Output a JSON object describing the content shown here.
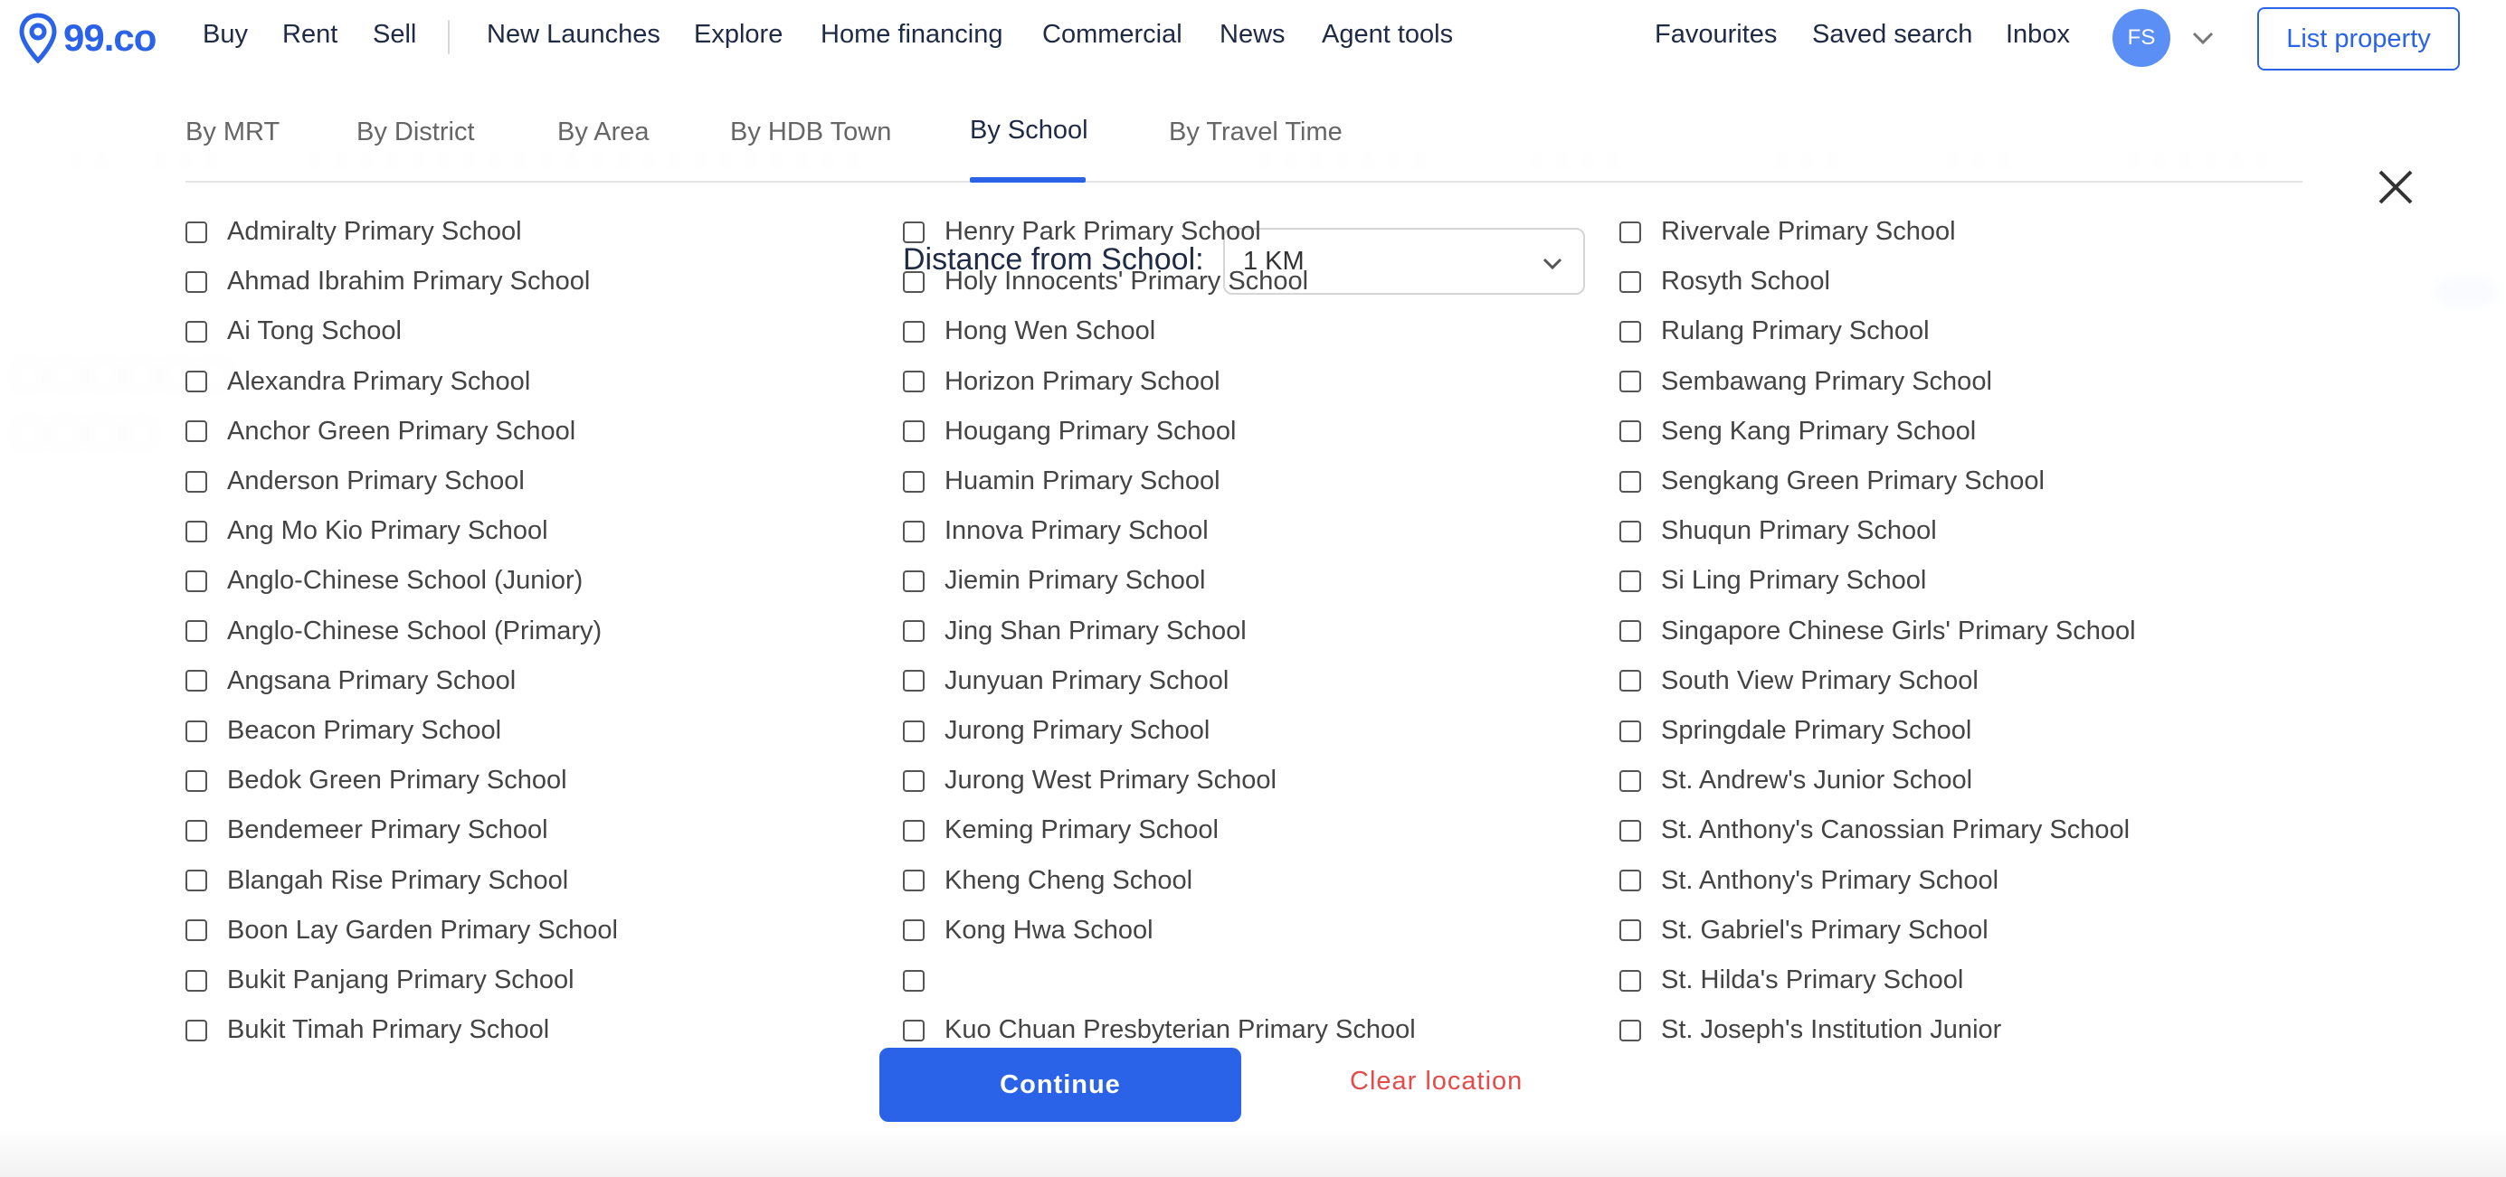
{
  "brand": {
    "logo_text": "99.co",
    "accent": "#2b63e8"
  },
  "nav": {
    "items": [
      "Buy",
      "Rent",
      "Sell",
      "New Launches",
      "Explore",
      "Home financing",
      "Commercial",
      "News",
      "Agent tools"
    ],
    "right_items": [
      "Favourites",
      "Saved search",
      "Inbox"
    ],
    "avatar_initials": "FS",
    "list_property_label": "List property"
  },
  "modal": {
    "tabs": [
      "By MRT",
      "By District",
      "By Area",
      "By HDB Town",
      "By School",
      "By Travel Time"
    ],
    "active_tab": "By School",
    "distance_label": "Distance from School:",
    "distance_value": "1 KM",
    "columns": [
      [
        "Admiralty Primary School",
        "Ahmad Ibrahim Primary School",
        "Ai Tong School",
        "Alexandra Primary School",
        "Anchor Green Primary School",
        "Anderson Primary School",
        "Ang Mo Kio Primary School",
        "Anglo-Chinese School (Junior)",
        "Anglo-Chinese School (Primary)",
        "Angsana Primary School",
        "Beacon Primary School",
        "Bedok Green Primary School",
        "Bendemeer Primary School",
        "Blangah Rise Primary School",
        "Boon Lay Garden Primary School",
        "Bukit Panjang Primary School",
        "Bukit Timah Primary School"
      ],
      [
        "Henry Park Primary School",
        "Holy Innocents' Primary School",
        "Hong Wen School",
        "Horizon Primary School",
        "Hougang Primary School",
        "Huamin Primary School",
        "Innova Primary School",
        "Jiemin Primary School",
        "Jing Shan Primary School",
        "Junyuan Primary School",
        "Jurong Primary School",
        "Jurong West Primary School",
        "Keming Primary School",
        "Kheng Cheng School",
        "Kong Hwa School",
        "",
        "Kuo Chuan Presbyterian Primary School"
      ],
      [
        "Rivervale Primary School",
        "Rosyth School",
        "Rulang Primary School",
        "Sembawang Primary School",
        "Seng Kang Primary School",
        "Sengkang Green Primary School",
        "Shuqun Primary School",
        "Si Ling Primary School",
        "Singapore Chinese Girls' Primary School",
        "South View Primary School",
        "Springdale Primary School",
        "St. Andrew's Junior School",
        "St. Anthony's Canossian Primary School",
        "St. Anthony's Primary School",
        "St. Gabriel's Primary School",
        "St. Hilda's Primary School",
        "St. Joseph's Institution Junior"
      ]
    ],
    "continue_label": "Continue",
    "clear_label": "Clear location"
  }
}
